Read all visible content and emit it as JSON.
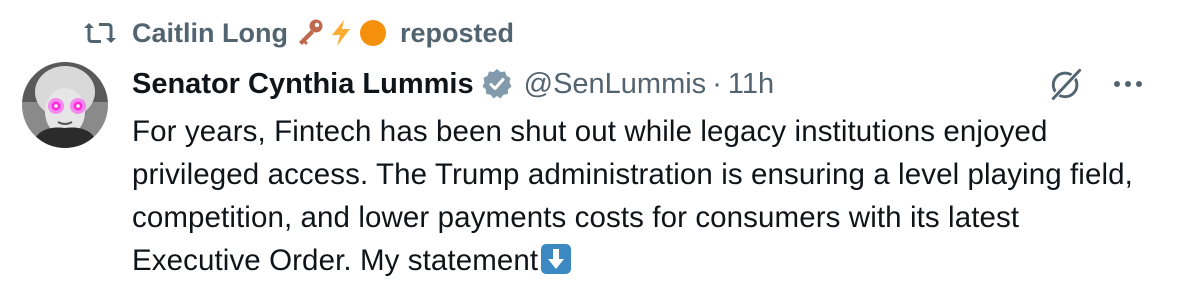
{
  "repost": {
    "reposter_name": "Caitlin Long",
    "emojis": [
      "key-emoji",
      "lightning-emoji",
      "orange-circle-emoji"
    ],
    "label": "reposted"
  },
  "tweet": {
    "display_name": "Senator Cynthia Lummis",
    "handle": "@SenLummis",
    "separator": "·",
    "time": "11h",
    "text": "For years, Fintech has been shut out while legacy institutions enjoyed privileged access. The Trump administration is ensuring a level playing field, competition, and lower payments costs for consumers with its latest Executive Order. My statement",
    "trailing_emoji": "down-arrow-emoji"
  },
  "colors": {
    "text_primary": "#0f1419",
    "text_secondary": "#536471",
    "verified_gray": "#829aab",
    "emoji_orange": "#f4900c",
    "emoji_key": "#c1694f",
    "emoji_bolt": "#ffac33",
    "arrow_blue": "#3b88c3"
  },
  "icons": {
    "repost": "repost-icon",
    "verified": "verified-badge-icon",
    "grok": "grok-icon",
    "more": "more-icon",
    "avatar": "avatar"
  }
}
